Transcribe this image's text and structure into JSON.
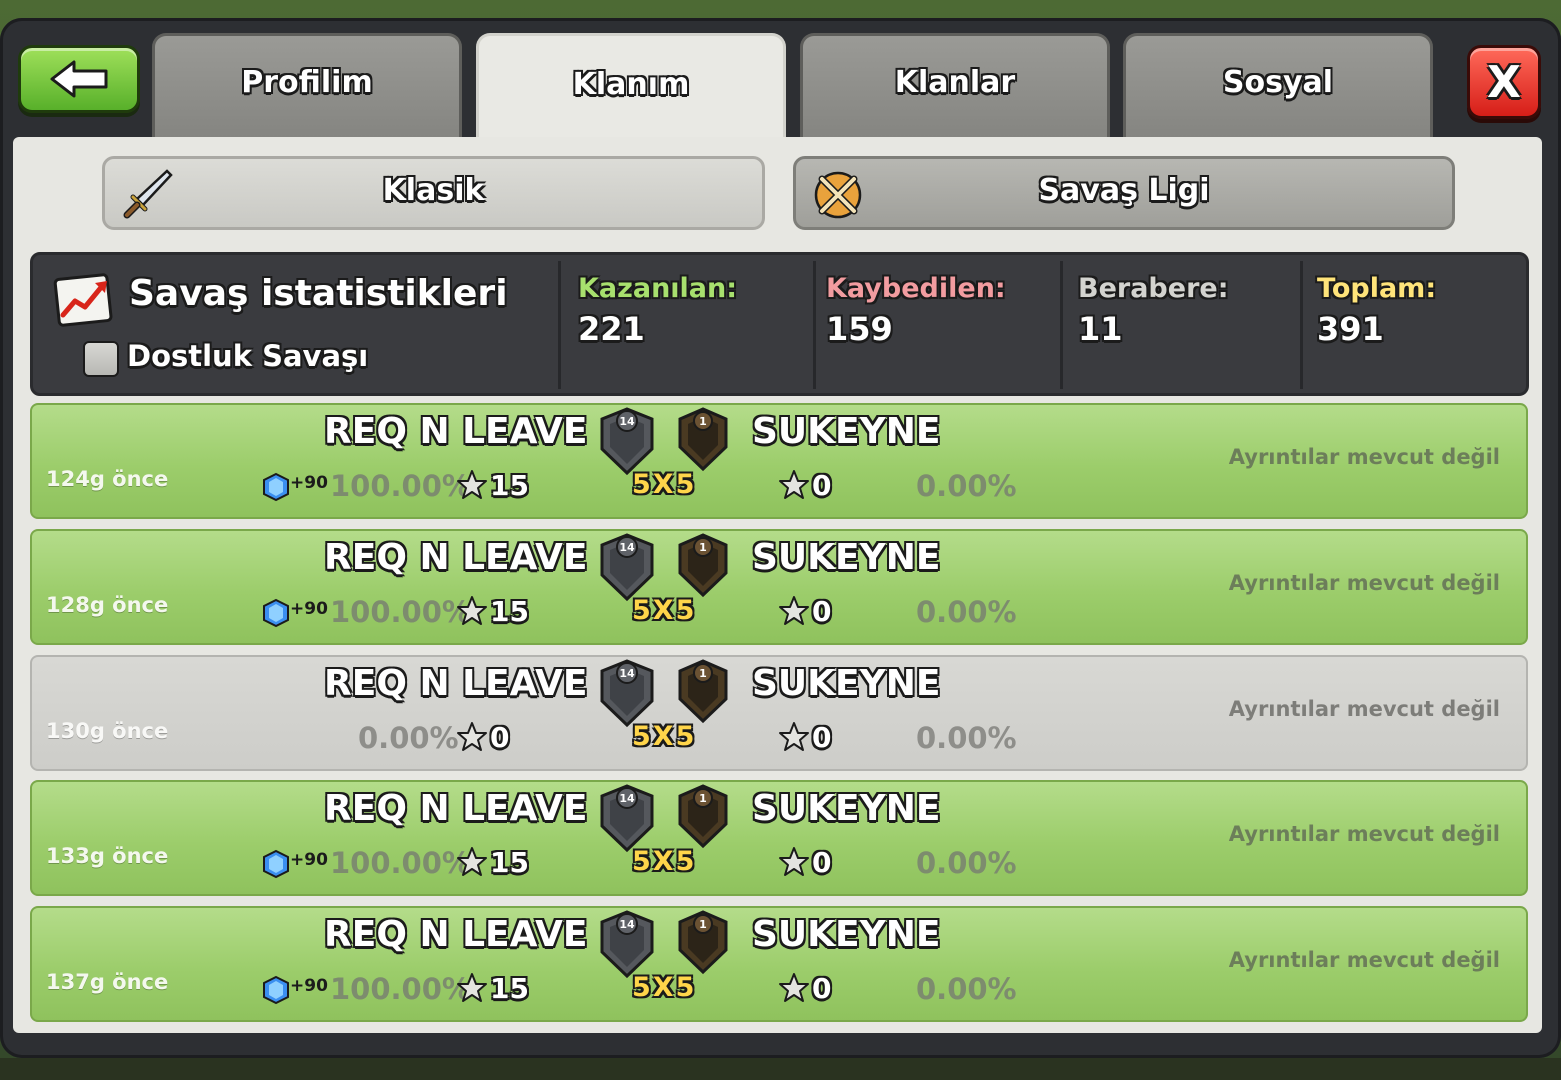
{
  "tabs": {
    "profile": "Profilim",
    "my_clan": "Klanım",
    "clans": "Klanlar",
    "social": "Sosyal"
  },
  "close_label": "X",
  "modes": {
    "classic": "Klasik",
    "league": "Savaş Ligi"
  },
  "stats": {
    "title": "Savaş istatistikleri",
    "friendly_label": "Dostluk Savaşı",
    "won_label": "Kazanılan:",
    "won_value": "221",
    "lost_label": "Kaybedilen:",
    "lost_value": "159",
    "draw_label": "Berabere:",
    "draw_value": "11",
    "total_label": "Toplam:",
    "total_value": "391"
  },
  "wars": [
    {
      "ago": "124g önce",
      "result": "win",
      "clan_a": "REQ N LEAVE",
      "clan_a_level": "14",
      "xp": "+90",
      "pct_a": "100.00%",
      "stars_a": "15",
      "size": "5X5",
      "clan_b": "SUKEYNE",
      "clan_b_level": "1",
      "stars_b": "0",
      "pct_b": "0.00%",
      "details": "Ayrıntılar mevcut değil"
    },
    {
      "ago": "128g önce",
      "result": "win",
      "clan_a": "REQ N LEAVE",
      "clan_a_level": "14",
      "xp": "+90",
      "pct_a": "100.00%",
      "stars_a": "15",
      "size": "5X5",
      "clan_b": "SUKEYNE",
      "clan_b_level": "1",
      "stars_b": "0",
      "pct_b": "0.00%",
      "details": "Ayrıntılar mevcut değil"
    },
    {
      "ago": "130g önce",
      "result": "neutral",
      "clan_a": "REQ N LEAVE",
      "clan_a_level": "14",
      "xp": "",
      "pct_a": "0.00%",
      "stars_a": "0",
      "size": "5X5",
      "clan_b": "SUKEYNE",
      "clan_b_level": "1",
      "stars_b": "0",
      "pct_b": "0.00%",
      "details": "Ayrıntılar mevcut değil"
    },
    {
      "ago": "133g önce",
      "result": "win",
      "clan_a": "REQ N LEAVE",
      "clan_a_level": "14",
      "xp": "+90",
      "pct_a": "100.00%",
      "stars_a": "15",
      "size": "5X5",
      "clan_b": "SUKEYNE",
      "clan_b_level": "1",
      "stars_b": "0",
      "pct_b": "0.00%",
      "details": "Ayrıntılar mevcut değil"
    },
    {
      "ago": "137g önce",
      "result": "win",
      "clan_a": "REQ N LEAVE",
      "clan_a_level": "14",
      "xp": "+90",
      "pct_a": "100.00%",
      "stars_a": "15",
      "size": "5X5",
      "clan_b": "SUKEYNE",
      "clan_b_level": "1",
      "stars_b": "0",
      "pct_b": "0.00%",
      "details": "Ayrıntılar mevcut değil"
    }
  ],
  "icons": {
    "back": "arrow-left-icon",
    "close": "close-icon",
    "classic": "sword-icon",
    "league": "crossed-swords-icon",
    "stats": "chart-icon",
    "xp": "xp-gem-icon",
    "star": "star-icon",
    "badge": "clan-badge-icon"
  },
  "colors": {
    "win_row": "#9ccd6b",
    "neutral_row": "#cdcdc9",
    "won_label": "#a8e06e",
    "lost_label": "#f29ca0",
    "total_label": "#ffe47a",
    "back_button": "#58b02a",
    "close_button": "#d61e18"
  }
}
